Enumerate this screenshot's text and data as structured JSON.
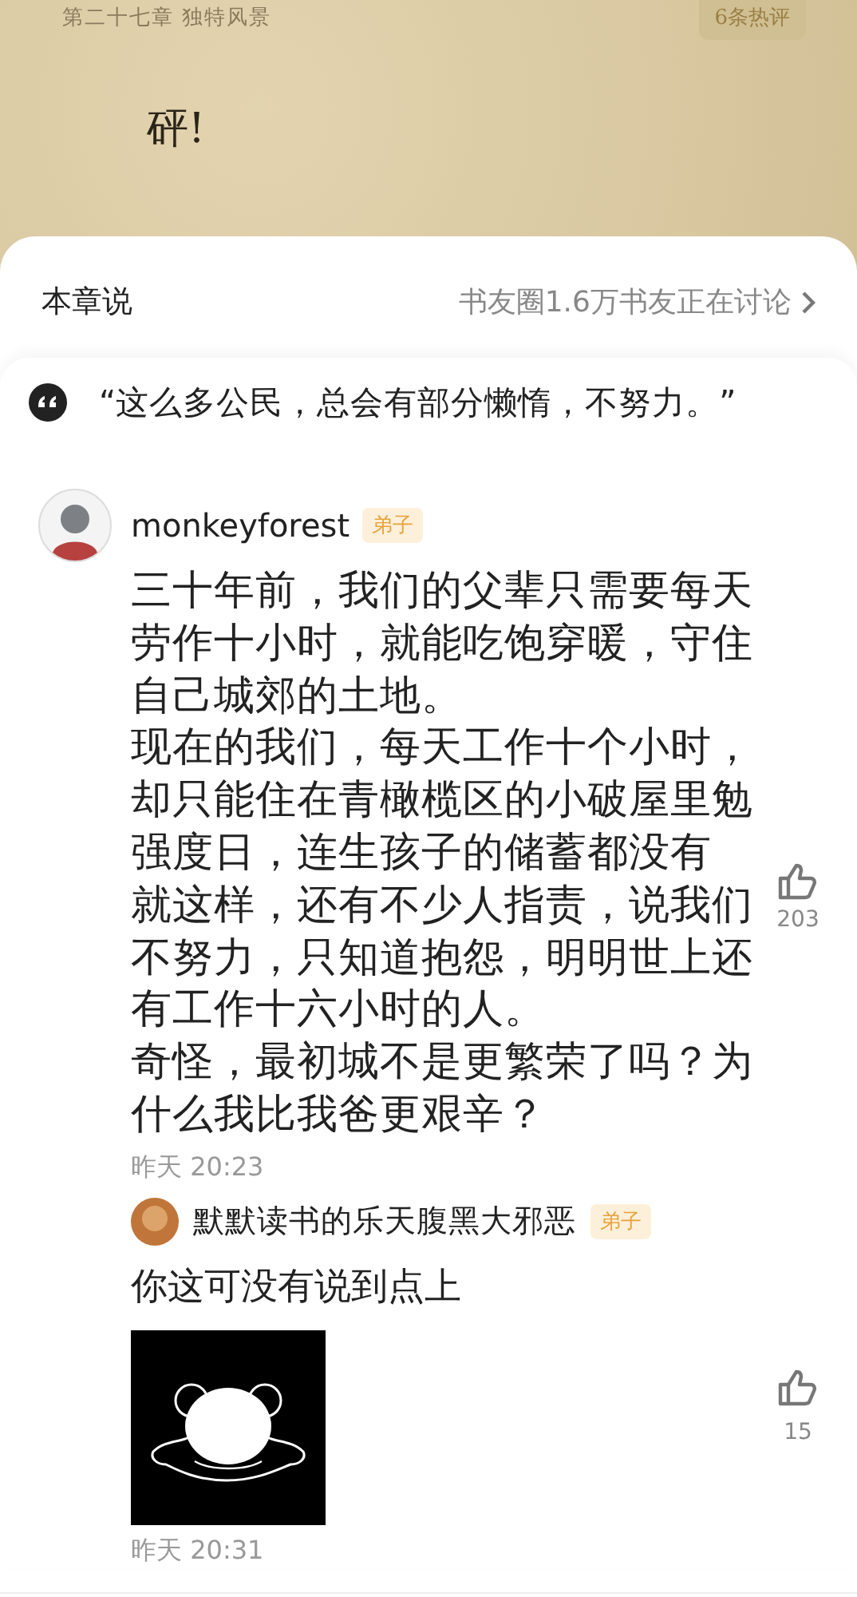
{
  "book_page": {
    "chapter_title": "第二十七章 独特风景",
    "hot_comments_button": "6条热评",
    "text_lines": [
      "砰!"
    ]
  },
  "sheet": {
    "title": "本章说",
    "discussion_link": "书友圈1.6万书友正在讨论"
  },
  "quote": "“这么多公民，总会有部分懒惰，不努力。”",
  "comment": {
    "user": "monkeyforest",
    "badge": "弟子",
    "paragraphs": [
      "三十年前，我们的父辈只需要每天劳作十小时，就能吃饱穿暖，守住自己城郊的土地。",
      "现在的我们，每天工作十个小时，却只能住在青橄榄区的小破屋里勉强度日，连生孩子的储蓄都没有",
      "就这样，还有不少人指责，说我们不努力，只知道抱怨，明明世上还有工作十六小时的人。",
      "奇怪，最初城不是更繁荣了吗？为什么我比我爸更艰辛？"
    ],
    "likes": "203",
    "time": "昨天 20:23"
  },
  "reply": {
    "user": "默默读书的乐天腹黑大邪恶",
    "badge": "弟子",
    "text": "你这可没有说到点上",
    "likes": "15",
    "time": "昨天 20:31"
  }
}
